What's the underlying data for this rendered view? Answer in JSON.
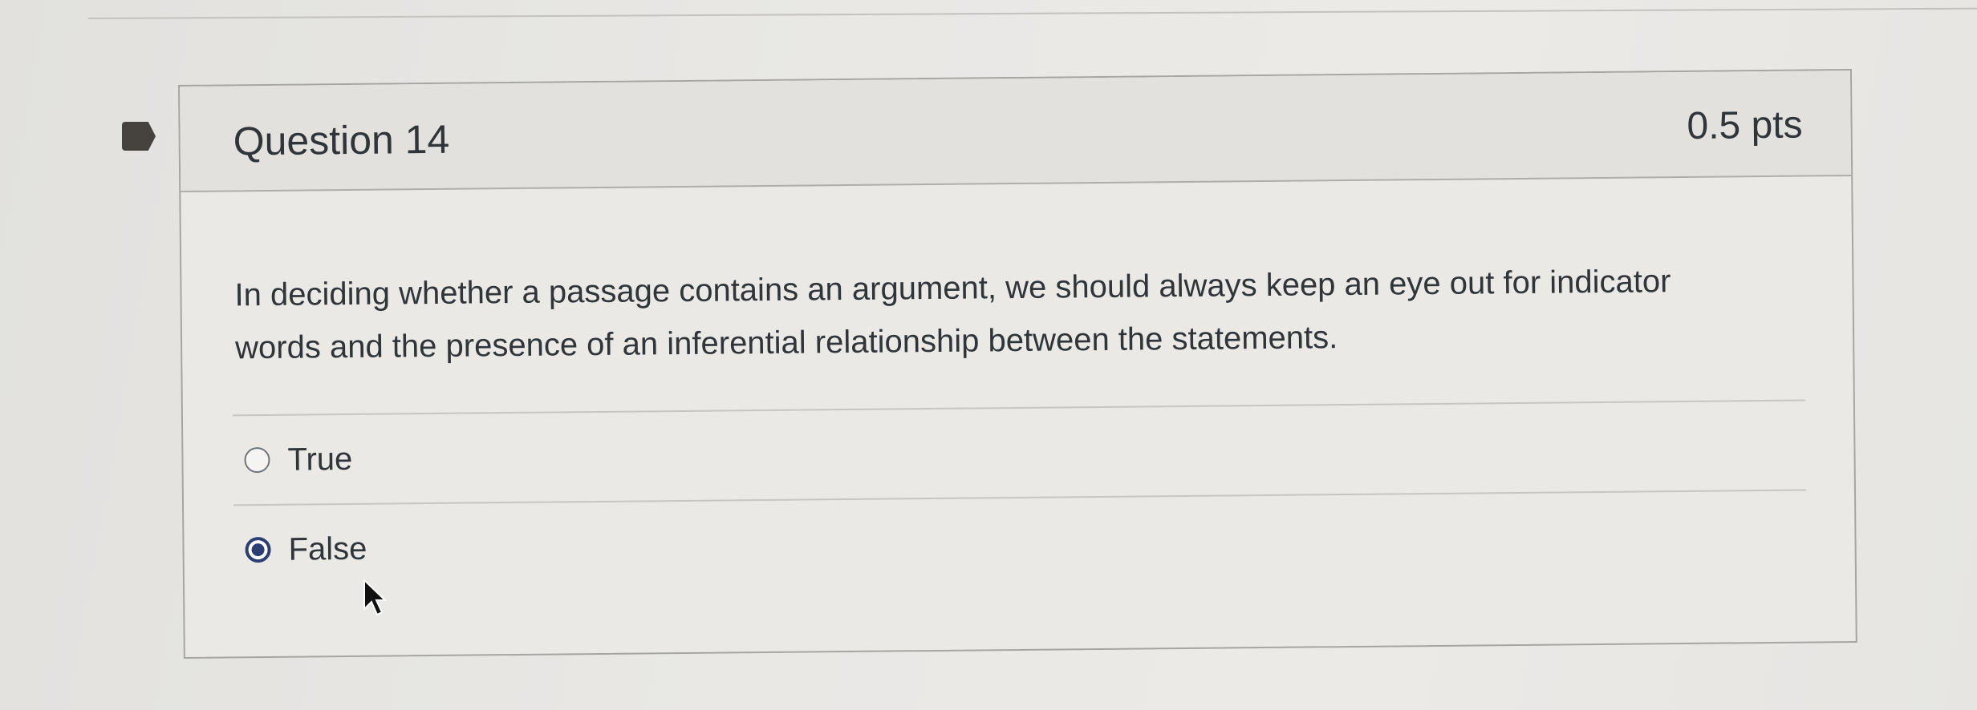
{
  "question": {
    "title": "Question 14",
    "points": "0.5 pts",
    "text": "In deciding whether a passage contains an argument, we should always keep an eye out for indicator words and the presence of an inferential relationship between the statements.",
    "answers": [
      {
        "label": "True",
        "selected": false
      },
      {
        "label": "False",
        "selected": true
      }
    ]
  },
  "colors": {
    "radio_selected": "#2c3e72",
    "text": "#2f3539",
    "flag": "#46423d"
  },
  "icons": {
    "flag": "question-flag-icon",
    "cursor": "mouse-pointer-icon"
  }
}
